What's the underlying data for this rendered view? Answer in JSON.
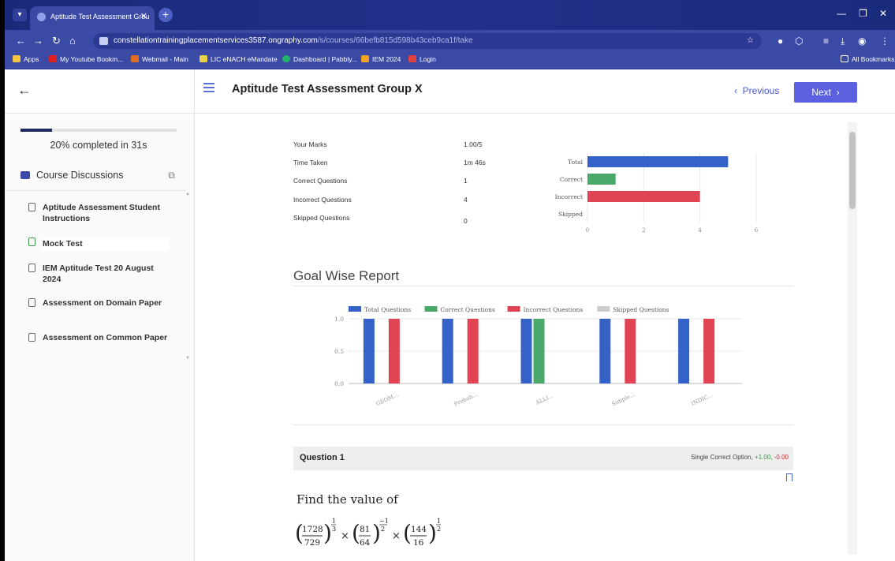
{
  "browser": {
    "tab_title": "Aptitude Test Assessment Grou",
    "url_host": "constellationtrainingplacementservices3587.ongraphy.com",
    "url_path": "/s/courses/66befb815d598b43ceb9ca1f/take",
    "bookmarks": [
      "Apps",
      "My Youtube Bookm...",
      "Webmail - Main",
      "LIC eNACH eMandate",
      "Dashboard | Pabbly...",
      "IEM 2024",
      "Login"
    ],
    "all_bookmarks": "All Bookmarks"
  },
  "header": {
    "course_title": "Aptitude Test Assessment Group X",
    "previous_label": "Previous",
    "next_label": "Next"
  },
  "sidebar": {
    "progress_percent": 20,
    "progress_text": "20% completed in 31s",
    "discussions_label": "Course Discussions",
    "items": [
      {
        "label": "Aptitude Assessment Student Instructions"
      },
      {
        "label": "Mock Test"
      },
      {
        "label": "IEM Aptitude Test 20 August 2024"
      },
      {
        "label": "Assessment on Domain Paper"
      },
      {
        "label": "Assessment on Common Paper"
      }
    ]
  },
  "summary": {
    "rows": [
      {
        "label": "Your Marks",
        "value": "1.00/5"
      },
      {
        "label": "Time Taken",
        "value": "1m 46s"
      },
      {
        "label": "Correct Questions",
        "value": "1"
      },
      {
        "label": "Incorrect Questions",
        "value": "4"
      },
      {
        "label": "Skipped Questions",
        "value": "0"
      }
    ]
  },
  "goal_report": {
    "title": "Goal Wise Report"
  },
  "question": {
    "title": "Question 1",
    "type_label": "Single Correct Option,",
    "plus": "+1.00,",
    "minus": "-0.00",
    "prompt": "Find the value of"
  },
  "colors": {
    "total": "#3462c9",
    "correct": "#4aa86b",
    "incorrect": "#e04452",
    "skipped": "#cccccc",
    "accent": "#5b5fe0"
  },
  "chart_data": [
    {
      "type": "bar",
      "orientation": "horizontal",
      "categories": [
        "Total",
        "Correct",
        "Incorrect",
        "Skipped"
      ],
      "values": [
        5,
        1,
        4,
        0
      ],
      "xlim": [
        0,
        6
      ],
      "xticks": [
        "0",
        "2",
        "4",
        "6"
      ],
      "grid": true
    },
    {
      "type": "bar",
      "categories": [
        "GEOM...",
        "Probab...",
        "ALLI...",
        "Simple...",
        "INDIC..."
      ],
      "series": [
        {
          "name": "Total Questions",
          "values": [
            1,
            1,
            1,
            1,
            1
          ]
        },
        {
          "name": "Correct Questions",
          "values": [
            0,
            0,
            1,
            0,
            0
          ]
        },
        {
          "name": "Incorrect Questions",
          "values": [
            1,
            1,
            0,
            1,
            1
          ]
        },
        {
          "name": "Skipped Questions",
          "values": [
            0,
            0,
            0,
            0,
            0
          ]
        }
      ],
      "ylim": [
        0,
        1.0
      ],
      "yticks": [
        "0.0",
        "0.5",
        "1.0"
      ],
      "legend": "top",
      "grid": true
    }
  ]
}
